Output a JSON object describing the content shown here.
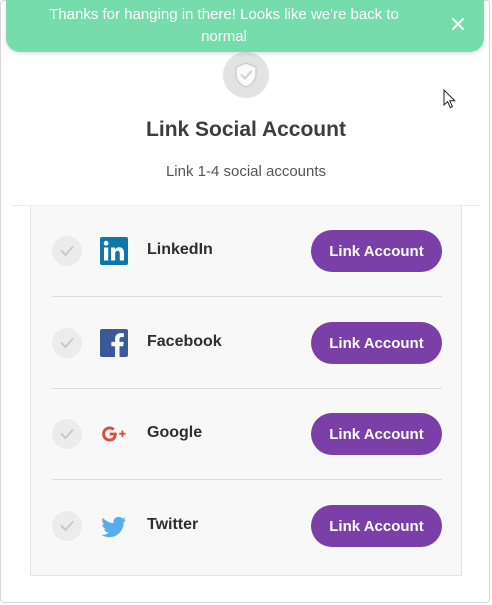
{
  "toast": {
    "message": "Thanks for hanging in there! Looks like we're back to normal",
    "close_icon": "close-icon",
    "color": "#77dcac"
  },
  "header": {
    "icon": "shield-check-icon",
    "title": "Link Social Account",
    "subtitle": "Link 1-4 social accounts"
  },
  "accounts": [
    {
      "name": "LinkedIn",
      "icon": "linkedin-icon",
      "icon_color": "#0e76a8",
      "button_label": "Link Account",
      "linked": false
    },
    {
      "name": "Facebook",
      "icon": "facebook-icon",
      "icon_color": "#3b5998",
      "button_label": "Link Account",
      "linked": false
    },
    {
      "name": "Google",
      "icon": "google-plus-icon",
      "icon_color": "#dd4b39",
      "button_label": "Link Account",
      "linked": false
    },
    {
      "name": "Twitter",
      "icon": "twitter-icon",
      "icon_color": "#55acee",
      "button_label": "Link Account",
      "linked": false
    }
  ],
  "colors": {
    "button": "#7b3fa8",
    "panel": "#f8f8f8"
  }
}
